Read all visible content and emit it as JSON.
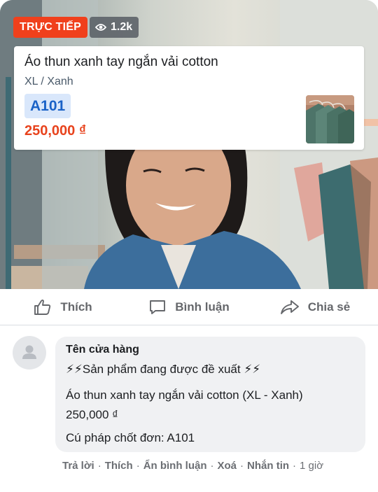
{
  "live": {
    "badge_label": "TRỰC TIẾP",
    "viewer_count": "1.2k"
  },
  "product": {
    "name": "Áo thun xanh tay ngắn vải cotton",
    "variant": "XL / Xanh",
    "code": "A101",
    "price": "250,000 ₫"
  },
  "actions": {
    "like": "Thích",
    "comment": "Bình luận",
    "share": "Chia sẻ"
  },
  "comment": {
    "author": "Tên cửa hàng",
    "line1": "⚡⚡Sản phẩm đang được đề xuất ⚡⚡",
    "line2": "Áo thun xanh tay ngắn vải cotton (XL - Xanh)",
    "line3": "250,000 ₫",
    "line4": "Cú pháp chốt đơn: A101"
  },
  "comment_meta": {
    "reply": "Trả lời",
    "like": "Thích",
    "hide": "Ẩn bình luận",
    "delete": "Xoá",
    "message": "Nhắn tin",
    "time": "1 giờ"
  },
  "colors": {
    "live_red": "#f0401c",
    "price_orange": "#e8431d",
    "code_blue": "#1a62c7",
    "code_bg": "#d9e7fb"
  },
  "icons": [
    "eye-icon",
    "like-icon",
    "comment-icon",
    "share-icon",
    "avatar-placeholder-icon"
  ]
}
